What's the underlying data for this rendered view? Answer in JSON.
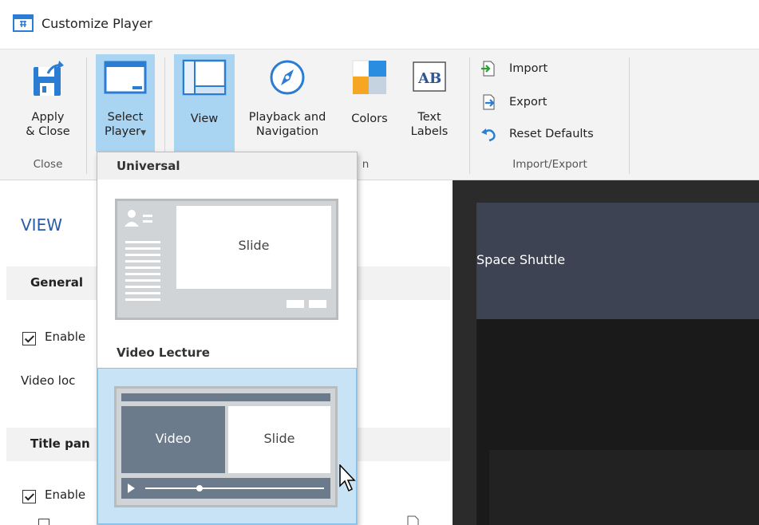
{
  "window": {
    "title": "Customize Player"
  },
  "ribbon": {
    "buttons": [
      {
        "line1": "Apply",
        "line2": "& Close"
      },
      {
        "line1": "Select",
        "line2": "Player"
      },
      {
        "line1": "View",
        "line2": ""
      },
      {
        "line1": "Playback and",
        "line2": "Navigation"
      },
      {
        "line1": "Colors",
        "line2": ""
      },
      {
        "line1": "Text",
        "line2": "Labels"
      }
    ],
    "small_buttons": [
      "Import",
      "Export",
      "Reset Defaults"
    ],
    "groups": {
      "close": "Close",
      "partial": "n",
      "import_export": "Import/Export"
    }
  },
  "panel": {
    "heading": "VIEW",
    "general_title": "General",
    "enable_1": "Enable",
    "video_loc": "Video loc",
    "title_panel": "Title pan",
    "enable_2": "Enable"
  },
  "preview": {
    "title": "Space Shuttle"
  },
  "dropdown": {
    "universal": {
      "header": "Universal",
      "slide_label": "Slide"
    },
    "video_lecture": {
      "header": "Video Lecture",
      "video_label": "Video",
      "slide_label": "Slide"
    }
  },
  "colors": {
    "accent": "#2a5ba8",
    "active_ribbon": "#a9d4f2",
    "selected_item": "#c7e3f5",
    "preview_header": "#3d4352"
  }
}
